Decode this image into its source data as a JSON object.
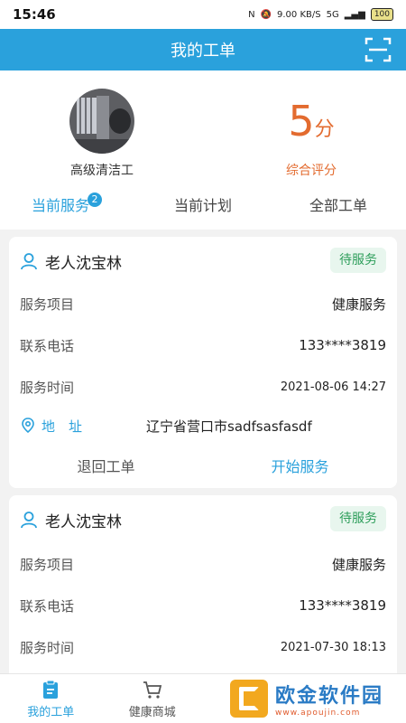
{
  "status_bar": {
    "time": "15:46",
    "net_speed": "9.00 KB/S",
    "signal": "5G",
    "battery": "100"
  },
  "header": {
    "title": "我的工单",
    "scan_icon": "scan-icon"
  },
  "profile": {
    "role": "高级清洁工",
    "score_value": "5",
    "score_unit": "分",
    "score_label": "综合评分"
  },
  "tabs": [
    {
      "label": "当前服务",
      "badge": "2",
      "active": true
    },
    {
      "label": "当前计划"
    },
    {
      "label": "全部工单"
    }
  ],
  "orders": [
    {
      "name": "老人沈宝林",
      "status": "待服务",
      "item_label": "服务项目",
      "item_value": "健康服务",
      "phone_label": "联系电话",
      "phone_value": "133****3819",
      "time_label": "服务时间",
      "time_value": "2021-08-06 14:27",
      "addr_label": "地　址",
      "addr_value": "辽宁省营口市sadfsasfasdf",
      "return_label": "退回工单",
      "start_label": "开始服务"
    },
    {
      "name": "老人沈宝林",
      "status": "待服务",
      "item_label": "服务项目",
      "item_value": "健康服务",
      "phone_label": "联系电话",
      "phone_value": "133****3819",
      "time_label": "服务时间",
      "time_value": "2021-07-30 18:13"
    }
  ],
  "bottom_nav": [
    {
      "label": "我的工单",
      "icon": "clipboard-icon",
      "active": true
    },
    {
      "label": "健康商城",
      "icon": "cart-icon"
    }
  ],
  "watermark": {
    "title": "欧金软件园",
    "sub": "www.apoujin.com"
  },
  "colors": {
    "primary": "#2aa1dc",
    "score": "#e36b2f",
    "status_green": "#2e9e5b"
  }
}
